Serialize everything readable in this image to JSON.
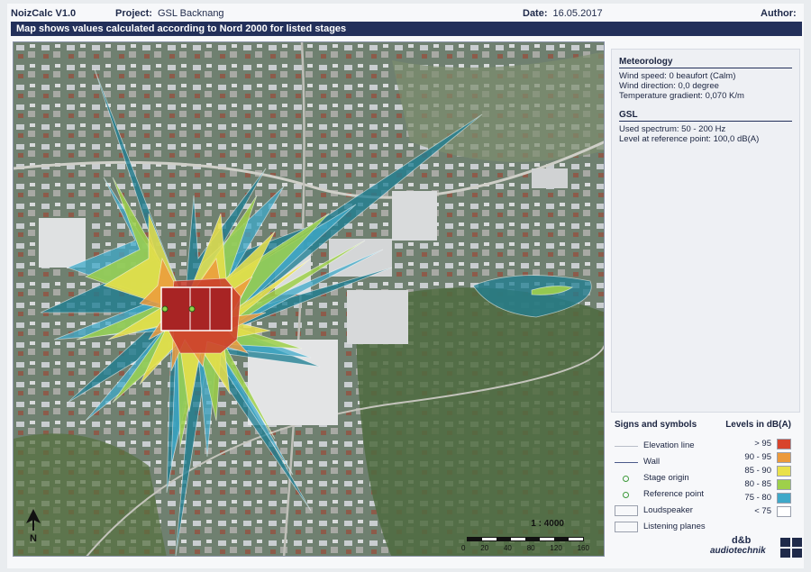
{
  "header": {
    "app_name": "NoizCalc V1.0",
    "project_label": "Project:",
    "project_value": "GSL Backnang",
    "date_label": "Date:",
    "date_value": "16.05.2017",
    "author_label": "Author:"
  },
  "title": "Map shows values calculated according to Nord 2000 for listed stages",
  "meteorology": {
    "heading": "Meteorology",
    "wind_speed": "Wind speed:  0 beaufort (Calm)",
    "wind_direction": "Wind direction:  0,0 degree",
    "temperature_gradient": "Temperature gradient:  0,070 K/m"
  },
  "gsl": {
    "heading": "GSL",
    "used_spectrum": "Used spectrum:  50 - 200 Hz",
    "reference_level": "Level at reference point:  100,0 dB(A)"
  },
  "signs": {
    "heading": "Signs and symbols",
    "items": [
      "Elevation line",
      "Wall",
      "Stage origin",
      "Reference point",
      "Loudspeaker",
      "Listening planes"
    ]
  },
  "levels": {
    "heading": "Levels in dB(A)",
    "items": [
      {
        "label": "> 95",
        "color": "#d8442c"
      },
      {
        "label": "90 - 95",
        "color": "#ec9a3c"
      },
      {
        "label": "85 - 90",
        "color": "#e9e14a"
      },
      {
        "label": "80 - 85",
        "color": "#9ed04a"
      },
      {
        "label": "75 - 80",
        "color": "#3fa9c9"
      },
      {
        "label": "< 75",
        "color": "#ffffff"
      }
    ]
  },
  "scale": {
    "ratio": "1 : 4000",
    "ticks": [
      "0",
      "20",
      "40",
      "80",
      "120",
      "160"
    ]
  },
  "north_label": "N",
  "brand": {
    "line1": "d&b",
    "line2": "audiotechnik"
  }
}
